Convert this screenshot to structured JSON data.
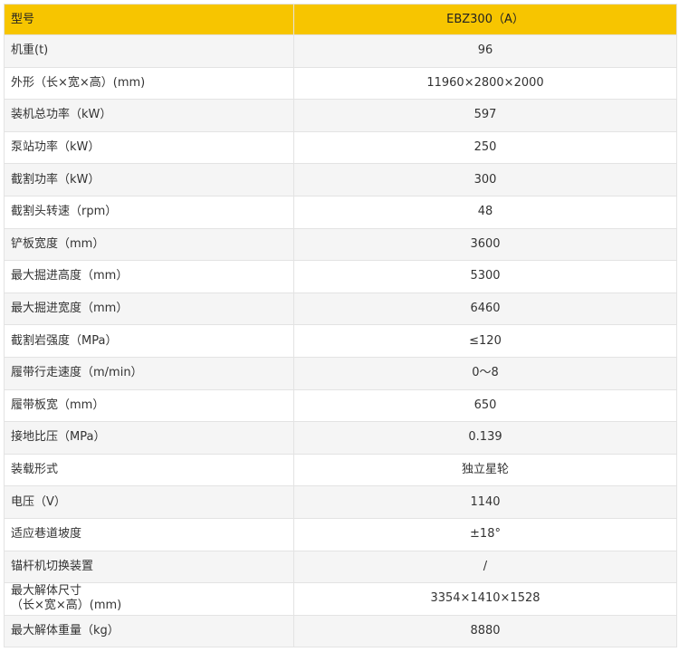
{
  "header": {
    "label": "型号",
    "value": "EBZ300（A）"
  },
  "rows": [
    {
      "label": "机重(t)",
      "value": "96"
    },
    {
      "label": "外形（长×宽×高）(mm)",
      "value": "11960×2800×2000"
    },
    {
      "label": "装机总功率（kW）",
      "value": "597"
    },
    {
      "label": "泵站功率（kW）",
      "value": "250"
    },
    {
      "label": "截割功率（kW）",
      "value": "300"
    },
    {
      "label": "截割头转速（rpm）",
      "value": "48"
    },
    {
      "label": "铲板宽度（mm）",
      "value": "3600"
    },
    {
      "label": "最大掘进高度（mm）",
      "value": "5300"
    },
    {
      "label": "最大掘进宽度（mm）",
      "value": "6460"
    },
    {
      "label": "截割岩强度（MPa）",
      "value": "≤120"
    },
    {
      "label": "履带行走速度（m/min）",
      "value": "0～8"
    },
    {
      "label": "履带板宽（mm）",
      "value": "650"
    },
    {
      "label": "接地比压（MPa）",
      "value": "0.139"
    },
    {
      "label": "装载形式",
      "value": "独立星轮"
    },
    {
      "label": "电压（V）",
      "value": "1140"
    },
    {
      "label": "适应巷道坡度",
      "value": "±18°"
    },
    {
      "label": "锚杆机切换装置",
      "value": "/"
    },
    {
      "label_line1": "最大解体尺寸",
      "label_line2": "（长×宽×高）(mm)",
      "value": "3354×1410×1528"
    },
    {
      "label": "最大解体重量（kg）",
      "value": "8880"
    }
  ],
  "colors": {
    "header_bg": "#f7c500",
    "row_alt_bg": "#f5f5f5",
    "row_bg": "#ffffff",
    "border": "#e3e3e3"
  }
}
